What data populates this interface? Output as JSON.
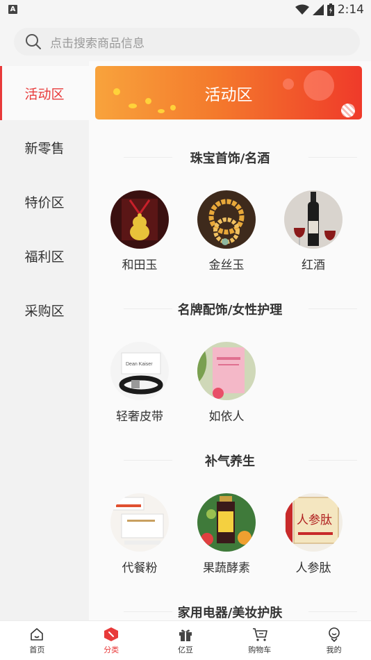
{
  "status_bar": {
    "time": "2:14",
    "app_indicator": "A"
  },
  "search": {
    "placeholder": "点击搜索商品信息"
  },
  "sidebar": {
    "items": [
      {
        "label": "活动区",
        "active": true
      },
      {
        "label": "新零售",
        "active": false
      },
      {
        "label": "特价区",
        "active": false
      },
      {
        "label": "福利区",
        "active": false
      },
      {
        "label": "采购区",
        "active": false
      }
    ]
  },
  "banner": {
    "title": "活动区"
  },
  "sections": [
    {
      "title": "珠宝首饰/名酒",
      "items": [
        {
          "label": "和田玉",
          "icon": "jade-pendant-image"
        },
        {
          "label": "金丝玉",
          "icon": "bead-bracelet-image"
        },
        {
          "label": "红酒",
          "icon": "red-wine-image"
        }
      ]
    },
    {
      "title": "名牌配饰/女性护理",
      "items": [
        {
          "label": "轻奢皮带",
          "icon": "belt-image"
        },
        {
          "label": "如依人",
          "icon": "care-product-image"
        }
      ]
    },
    {
      "title": "补气养生",
      "items": [
        {
          "label": "代餐粉",
          "icon": "meal-powder-image"
        },
        {
          "label": "果蔬酵素",
          "icon": "enzyme-drink-image"
        },
        {
          "label": "人参肽",
          "icon": "ginseng-peptide-image"
        }
      ]
    },
    {
      "title": "家用电器/美妆护肤"
    }
  ],
  "tabbar": {
    "items": [
      {
        "label": "首页",
        "icon": "home-icon"
      },
      {
        "label": "分类",
        "icon": "category-icon",
        "active": true
      },
      {
        "label": "亿豆",
        "icon": "gift-icon"
      },
      {
        "label": "购物车",
        "icon": "cart-icon"
      },
      {
        "label": "我的",
        "icon": "profile-icon"
      }
    ]
  },
  "colors": {
    "accent": "#e83a3a",
    "banner_start": "#f8a33c",
    "banner_end": "#ef3a2a"
  }
}
